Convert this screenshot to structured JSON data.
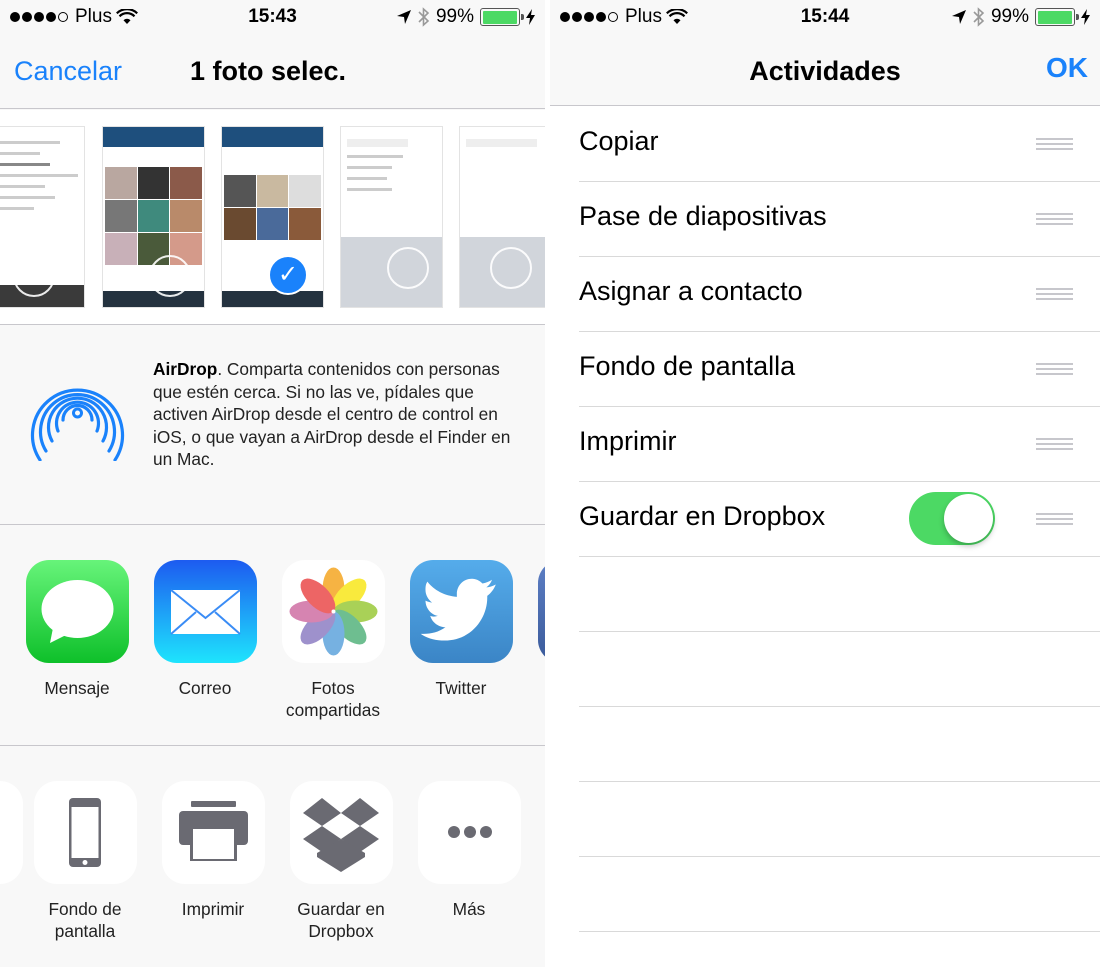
{
  "left": {
    "status": {
      "carrier": "Plus",
      "time": "15:43",
      "battery": "99%",
      "battery_level": 0.99
    },
    "nav": {
      "cancel_label": "Cancelar",
      "title": "1 foto selec."
    },
    "thumbnails": {
      "count": 5,
      "selected_index": 2,
      "selected_state": "checked"
    },
    "airdrop": {
      "title": "AirDrop",
      "text": ". Comparta contenidos con personas que estén cerca. Si no las ve, pídales que activen AirDrop desde el centro de control en iOS, o que vayan a AirDrop desde el Finder en un Mac."
    },
    "share_apps": [
      {
        "label": "Mensaje",
        "icon": "messages-icon"
      },
      {
        "label": "Correo",
        "icon": "mail-icon"
      },
      {
        "label": "Fotos compartidas",
        "icon": "photos-icon"
      },
      {
        "label": "Twitter",
        "icon": "twitter-icon"
      }
    ],
    "actions": [
      {
        "label": "Fondo de pantalla",
        "icon": "phone-icon"
      },
      {
        "label": "Imprimir",
        "icon": "printer-icon"
      },
      {
        "label": "Guardar en Dropbox",
        "icon": "dropbox-icon"
      },
      {
        "label": "Más",
        "icon": "more-icon"
      }
    ]
  },
  "right": {
    "status": {
      "carrier": "Plus",
      "time": "15:44",
      "battery": "99%",
      "battery_level": 0.99
    },
    "nav": {
      "title": "Actividades",
      "ok_label": "OK"
    },
    "activities": [
      {
        "label": "Copiar",
        "has_toggle": false
      },
      {
        "label": "Pase de diapositivas",
        "has_toggle": false
      },
      {
        "label": "Asignar a contacto",
        "has_toggle": false
      },
      {
        "label": "Fondo de pantalla",
        "has_toggle": false
      },
      {
        "label": "Imprimir",
        "has_toggle": false
      },
      {
        "label": "Guardar en Dropbox",
        "has_toggle": true,
        "toggle_on": true
      }
    ],
    "empty_rows": 5
  },
  "colors": {
    "accent": "#1a82fb",
    "toggle_on": "#4cd964",
    "glyph_gray": "#6a6a72"
  }
}
